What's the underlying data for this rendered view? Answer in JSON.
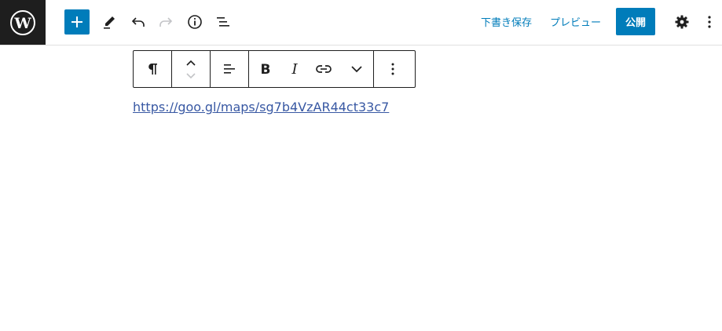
{
  "header": {
    "save_draft_label": "下書き保存",
    "preview_label": "プレビュー",
    "publish_label": "公開",
    "accent_color": "#007cba",
    "logo_background": "#1e1e1e"
  },
  "toolbar": {
    "icons": [
      "paragraph-icon",
      "move-up-icon",
      "move-down-icon",
      "align-icon",
      "bold-icon",
      "italic-icon",
      "link-icon",
      "more-rich-text-icon",
      "block-options-icon"
    ]
  },
  "content": {
    "link_text": "https://goo.gl/maps/sg7b4VzAR44ct33c7",
    "link_color": "#3858a3"
  }
}
